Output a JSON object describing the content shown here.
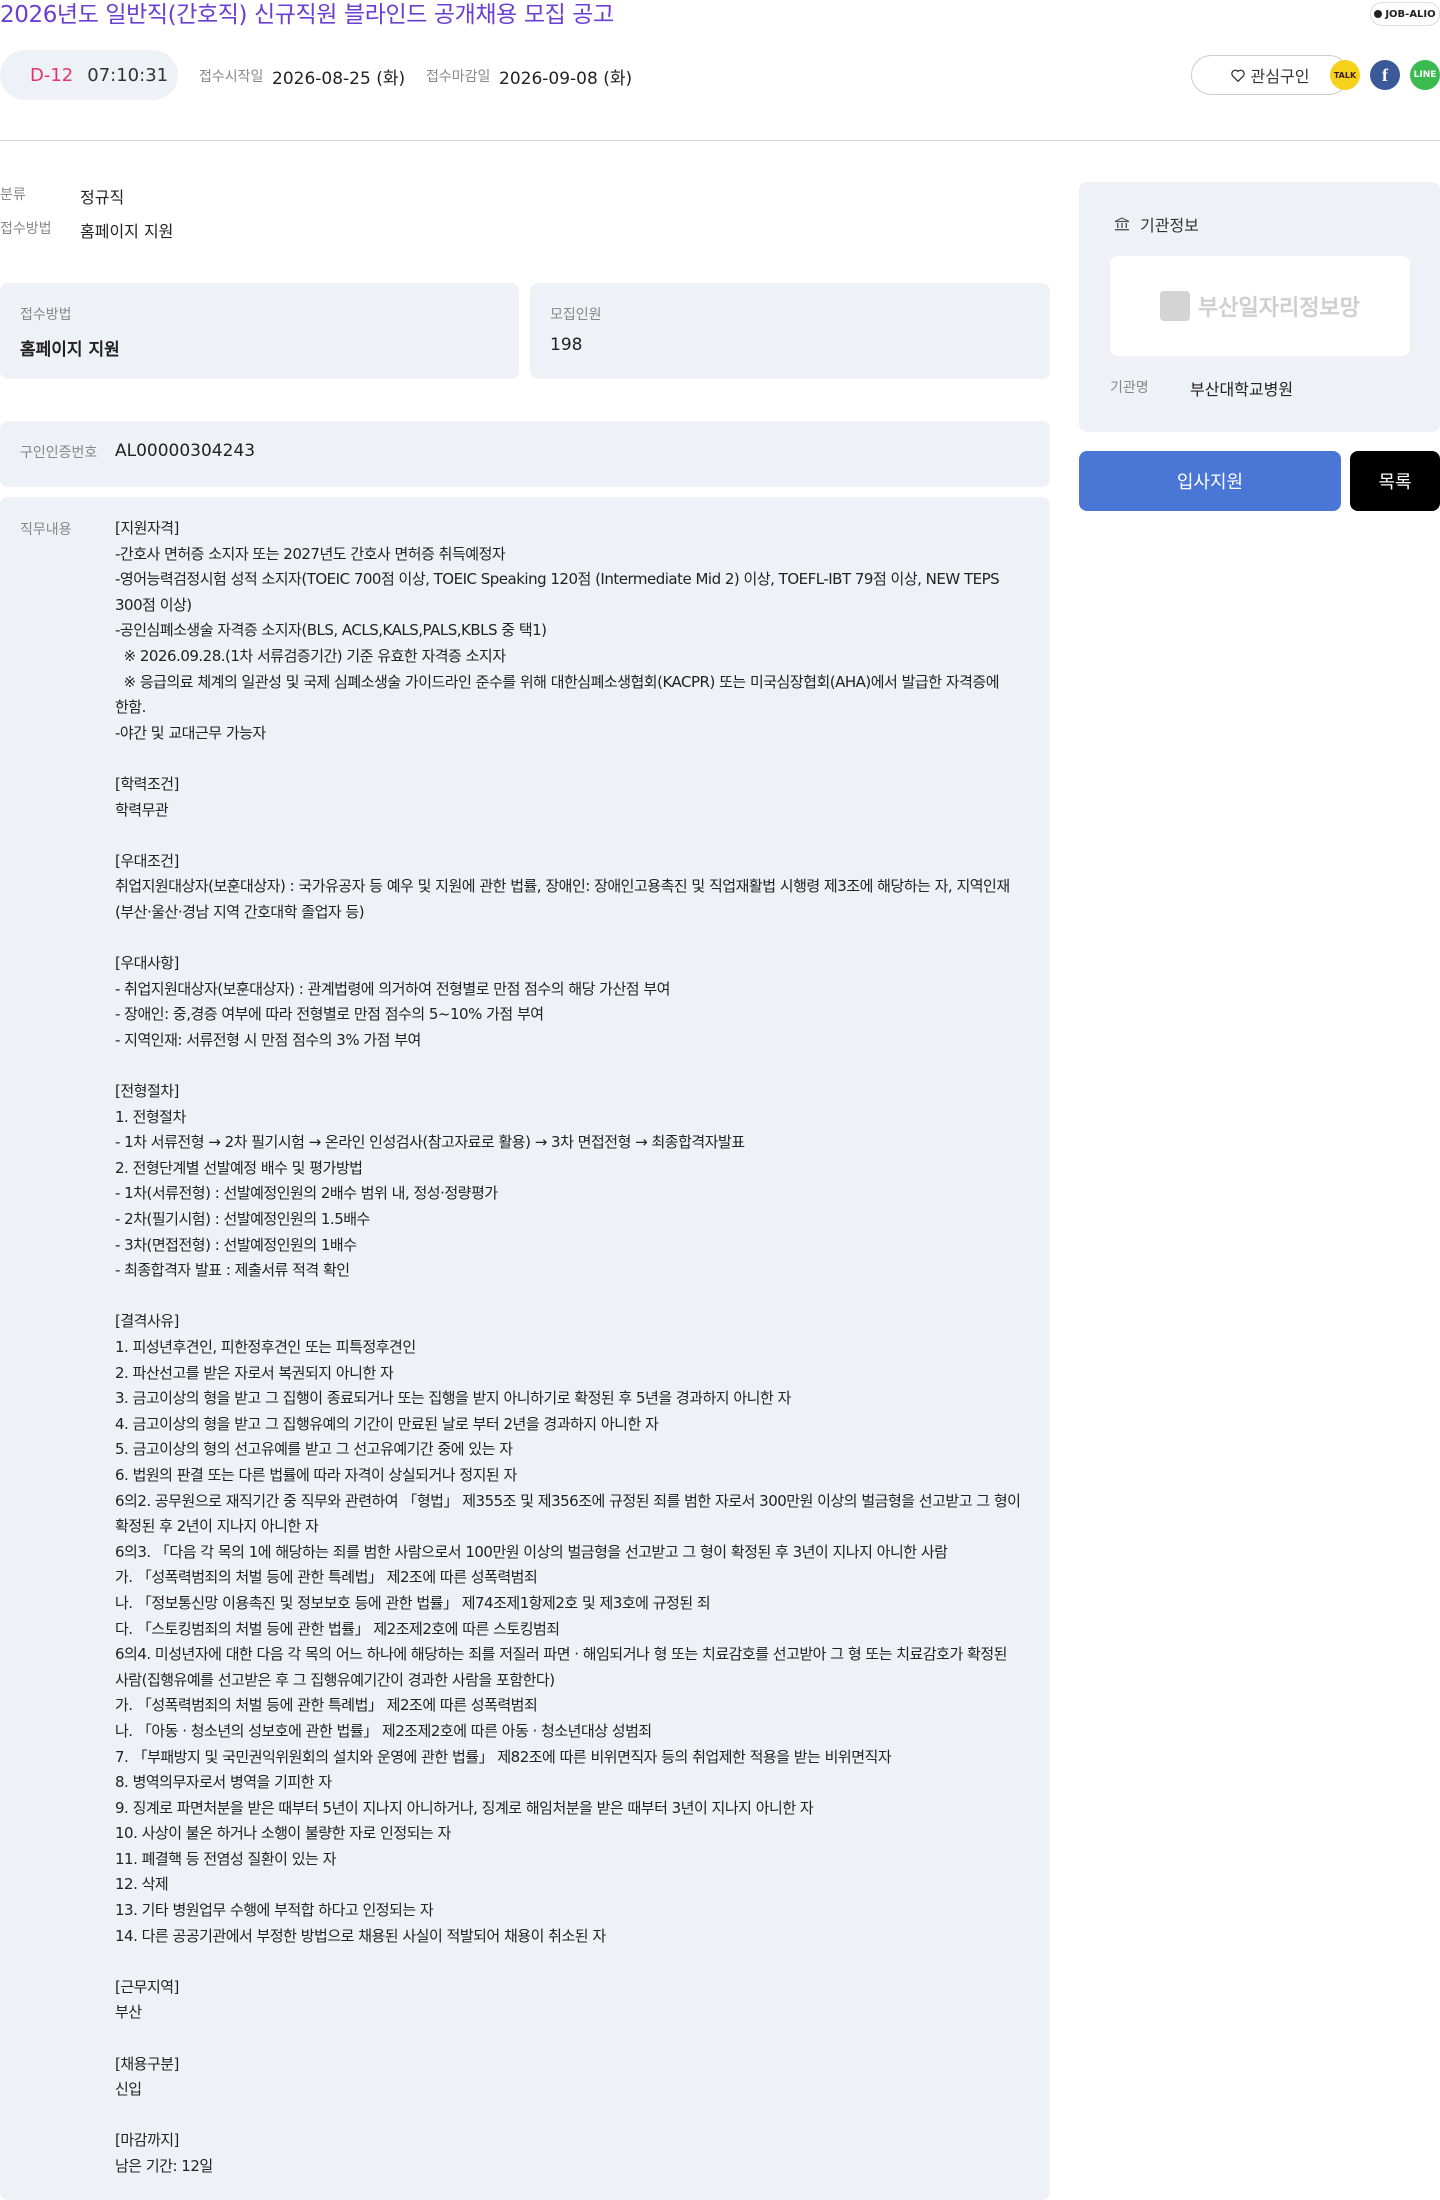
{
  "header": {
    "title": "2026년도 일반직(간호직) 신규직원 블라인드 공개채용 모집 공고",
    "brand_badge": "JOB-ALIO"
  },
  "countdown": {
    "dday": "D-12",
    "time": "07:10:31"
  },
  "dates": {
    "start_label": "접수시작일",
    "start_value": "2026-08-25 (화)",
    "end_label": "접수마감일",
    "end_value": "2026-09-08 (화)"
  },
  "actions": {
    "favorite_label": "관심구인",
    "favorite_icon": "heart-icon",
    "kakao_label": "TALK",
    "facebook_label": "f",
    "line_label": "LINE",
    "apply_label": "입사지원",
    "list_label": "목록"
  },
  "meta": {
    "category_label": "분류",
    "category_value": "정규직",
    "method_label": "접수방법",
    "method_value": "홈페이지 지원"
  },
  "cards": {
    "method_label": "접수방법",
    "method_value": "홈페이지 지원",
    "headcount_label": "모집인원",
    "headcount_value": "198",
    "cert_label": "구인인증번호",
    "cert_value": "AL00000304243"
  },
  "duty": {
    "label": "직무내용",
    "text": "[지원자격]\n-간호사 면허증 소지자 또는 2027년도 간호사 면허증 취득예정자\n-영어능력검정시험 성적 소지자(TOEIC 700점 이상, TOEIC Speaking 120점 (Intermediate Mid 2) 이상, TOEFL-IBT 79점 이상, NEW TEPS 300점 이상)\n-공인심폐소생술 자격증 소지자(BLS, ACLS,KALS,PALS,KBLS 중 택1)\n  ※ 2026.09.28.(1차 서류검증기간) 기준 유효한 자격증 소지자\n  ※ 응급의료 체계의 일관성 및 국제 심폐소생술 가이드라인 준수를 위해 대한심폐소생협회(KACPR) 또는 미국심장협회(AHA)에서 발급한 자격증에 한함.\n-야간 및 교대근무 가능자\n\n[학력조건]\n학력무관\n\n[우대조건]\n취업지원대상자(보훈대상자) : 국가유공자 등 예우 및 지원에 관한 법률, 장애인: 장애인고용촉진 및 직업재활법 시행령 제3조에 해당하는 자, 지역인재(부산·울산·경남 지역 간호대학 졸업자 등)\n\n[우대사항]\n- 취업지원대상자(보훈대상자) : 관계법령에 의거하여 전형별로 만점 점수의 해당 가산점 부여\n- 장애인: 중,경증 여부에 따라 전형별로 만점 점수의 5~10% 가점 부여\n- 지역인재: 서류전형 시 만점 점수의 3% 가점 부여\n\n[전형절차]\n1. 전형절차\n- 1차 서류전형 → 2차 필기시험 → 온라인 인성검사(참고자료로 활용) → 3차 면접전형 → 최종합격자발표\n2. 전형단계별 선발예정 배수 및 평가방법\n- 1차(서류전형) : 선발예정인원의 2배수 범위 내, 정성·정량평가\n- 2차(필기시험) : 선발예정인원의 1.5배수\n- 3차(면접전형) : 선발예정인원의 1배수\n- 최종합격자 발표 : 제출서류 적격 확인\n\n[결격사유]\n1. 피성년후견인, 피한정후견인 또는 피특정후견인\n2. 파산선고를 받은 자로서 복권되지 아니한 자\n3. 금고이상의 형을 받고 그 집행이 종료되거나 또는 집행을 받지 아니하기로 확정된 후 5년을 경과하지 아니한 자\n4. 금고이상의 형을 받고 그 집행유예의 기간이 만료된 날로 부터 2년을 경과하지 아니한 자\n5. 금고이상의 형의 선고유예를 받고 그 선고유예기간 중에 있는 자\n6. 법원의 판결 또는 다른 법률에 따라 자격이 상실되거나 정지된 자\n6의2. 공무원으로 재직기간 중 직무와 관련하여 「형법」 제355조 및 제356조에 규정된 죄를 범한 자로서 300만원 이상의 벌금형을 선고받고 그 형이 확정된 후 2년이 지나지 아니한 자\n6의3. 「다음 각 목의 1에 해당하는 죄를 범한 사람으로서 100만원 이상의 벌금형을 선고받고 그 형이 확정된 후 3년이 지나지 아니한 사람\n가. 「성폭력범죄의 처벌 등에 관한 특례법」 제2조에 따른 성폭력범죄\n나. 「정보통신망 이용촉진 및 정보보호 등에 관한 법률」 제74조제1항제2호 및 제3호에 규정된 죄\n다. 「스토킹범죄의 처벌 등에 관한 법률」 제2조제2호에 따른 스토킹범죄\n6의4. 미성년자에 대한 다음 각 목의 어느 하나에 해당하는 죄를 저질러 파면 · 해임되거나 형 또는 치료감호를 선고받아 그 형 또는 치료감호가 확정된 사람(집행유예를 선고받은 후 그 집행유예기간이 경과한 사람을 포함한다)\n가. 「성폭력범죄의 처벌 등에 관한 특례법」 제2조에 따른 성폭력범죄\n나. 「아동 · 청소년의 성보호에 관한 법률」 제2조제2호에 따른 아동 · 청소년대상 성범죄\n7. 「부패방지 및 국민권익위원회의 설치와 운영에 관한 법률」 제82조에 따른 비위면직자 등의 취업제한 적용을 받는 비위면직자\n8. 병역의무자로서 병역을 기피한 자\n9. 징계로 파면처분을 받은 때부터 5년이 지나지 아니하거나, 징계로 해임처분을 받은 때부터 3년이 지나지 아니한 자\n10. 사상이 불온 하거나 소행이 불량한 자로 인정되는 자\n11. 폐결핵 등 전염성 질환이 있는 자\n12. 삭제\n13. 기타 병원업무 수행에 부적합 하다고 인정되는 자\n14. 다른 공공기관에서 부정한 방법으로 채용된 사실이 적발되어 채용이 취소된 자\n\n[근무지역]\n부산\n\n[채용구분]\n신입\n\n[마감까지]\n남은 기간: 12일"
  },
  "agency": {
    "heading": "기관정보",
    "logo_text": "부산일자리정보망",
    "name_label": "기관명",
    "name_value": "부산대학교병원"
  },
  "colors": {
    "title": "#6b3fd1",
    "dday": "#e6336b",
    "apply": "#4a76d5",
    "panel": "#eef1f6"
  }
}
